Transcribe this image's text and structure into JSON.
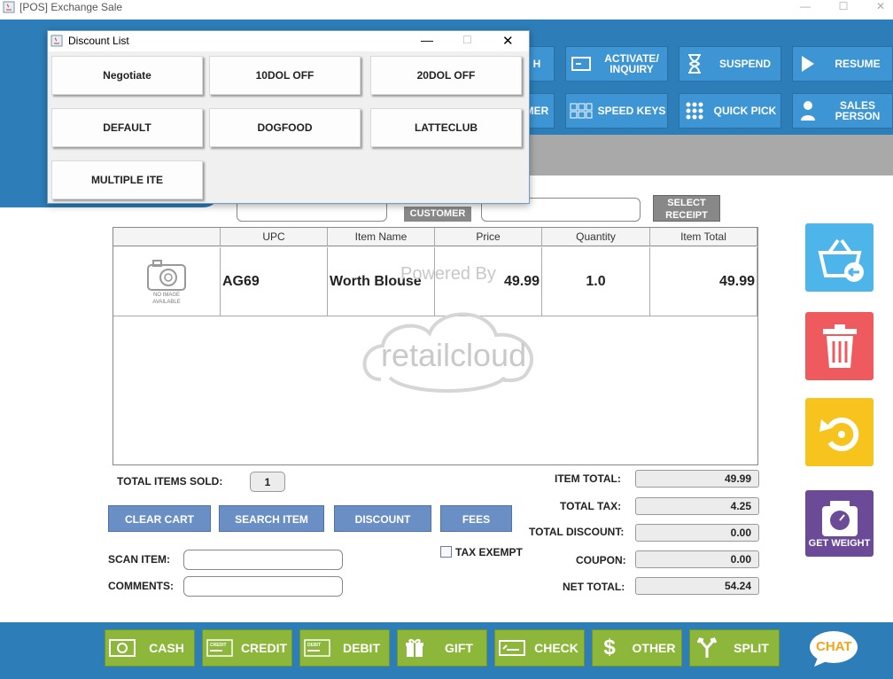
{
  "window": {
    "title": "[POS] Exchange Sale"
  },
  "toolbar": {
    "activate": "ACTIVATE/ INQUIRY",
    "suspend": "SUSPEND",
    "resume": "RESUME",
    "customer_partial": "MER",
    "speed_keys": "SPEED KEYS",
    "quick_pick": "QUICK PICK",
    "sales_person": "SALES PERSON",
    "partial_h": "H"
  },
  "customer": {
    "label": "CUSTOMER",
    "select_receipt": "SELECT RECEIPT"
  },
  "table": {
    "columns": [
      "",
      "UPC",
      "Item Name",
      "Price",
      "Quantity",
      "Item Total"
    ],
    "rows": [
      {
        "image_text": "NO IMAGE AVAILABLE",
        "upc": "AG69",
        "item_name": "Worth Blouse",
        "price": "49.99",
        "quantity": "1.0",
        "item_total": "49.99"
      }
    ],
    "watermark_top": "Powered By",
    "watermark_brand": "retailcloud"
  },
  "summary": {
    "total_items_label": "TOTAL ITEMS SOLD:",
    "total_items_value": "1",
    "item_total_label": "ITEM TOTAL:",
    "item_total_value": "49.99",
    "total_tax_label": "TOTAL TAX:",
    "total_tax_value": "4.25",
    "total_discount_label": "TOTAL DISCOUNT:",
    "total_discount_value": "0.00",
    "coupon_label": "COUPON:",
    "coupon_value": "0.00",
    "net_total_label": "NET TOTAL:",
    "net_total_value": "54.24",
    "tax_exempt_label": "TAX EXEMPT"
  },
  "actions": {
    "clear_cart": "CLEAR CART",
    "search_item": "SEARCH ITEM",
    "discount": "DISCOUNT",
    "fees": "FEES"
  },
  "inputs": {
    "scan_item_label": "SCAN ITEM:",
    "comments_label": "COMMENTS:"
  },
  "side": {
    "get_weight": "GET WEIGHT"
  },
  "payment": {
    "cash": "CASH",
    "credit": "CREDIT",
    "debit": "DEBIT",
    "gift": "GIFT",
    "check": "CHECK",
    "other": "OTHER",
    "split": "SPLIT",
    "chat": "CHAT",
    "credit_card_text": "CREDIT",
    "debit_card_text": "DEBIT"
  },
  "dialog": {
    "title": "Discount List",
    "buttons": [
      "Negotiate",
      "10DOL OFF",
      "20DOL OFF",
      "DEFAULT",
      "DOGFOOD",
      "LATTECLUB",
      "MULTIPLE ITE"
    ]
  },
  "colors": {
    "header_blue": "#2d7eb8",
    "button_blue": "#3d95d4",
    "pay_green": "#8cb73b",
    "action_blue": "#6a8fc4",
    "return_cyan": "#4db5ea",
    "delete_red": "#ef5a5f",
    "undo_yellow": "#f6c41c",
    "weight_purple": "#6b4a97"
  }
}
